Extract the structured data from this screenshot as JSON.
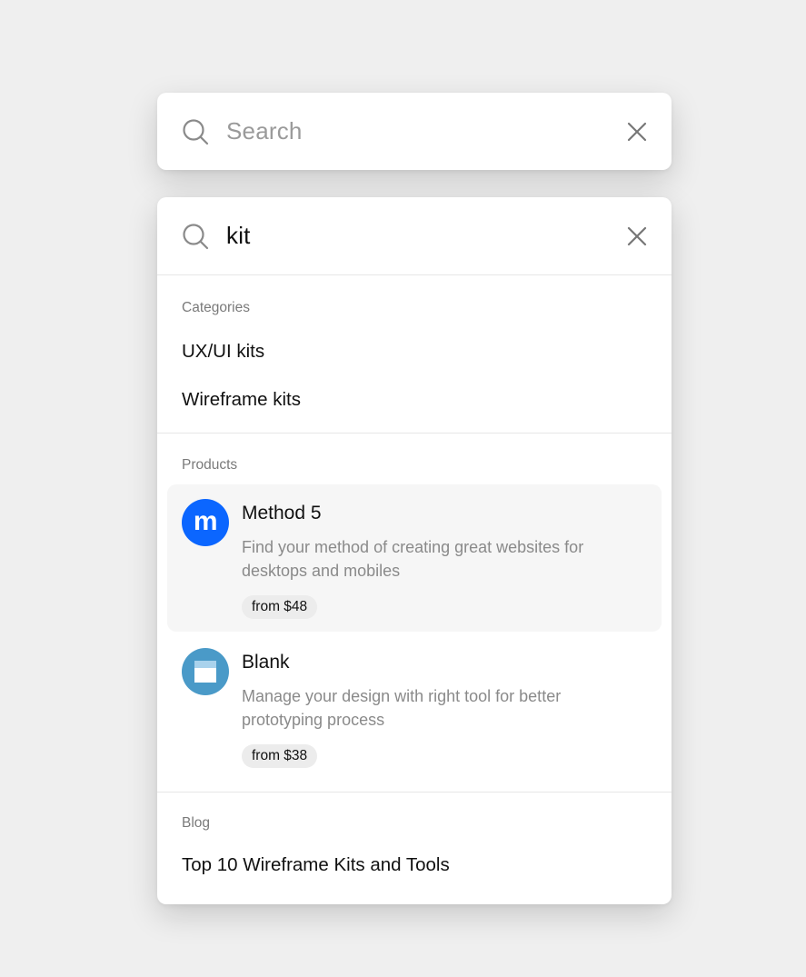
{
  "empty_search": {
    "placeholder": "Search",
    "icon": "search-icon",
    "clear_icon": "close-icon"
  },
  "active_search": {
    "query": "kit",
    "icon": "search-icon",
    "clear_icon": "close-icon"
  },
  "sections": {
    "categories": {
      "label": "Categories",
      "items": [
        "UX/UI kits",
        "Wireframe kits"
      ]
    },
    "products": {
      "label": "Products",
      "items": [
        {
          "title": "Method 5",
          "description": "Find your method of creating great websites for desktops and mobiles",
          "price": "from $48",
          "logo_letter": "m",
          "logo_color": "#0b66ff",
          "highlighted": true
        },
        {
          "title": "Blank",
          "description": "Manage your design with right tool for better prototyping process",
          "price": "from $38",
          "logo_icon": "window-icon",
          "logo_color": "#4a9ac8",
          "highlighted": false
        }
      ]
    },
    "blog": {
      "label": "Blog",
      "items": [
        "Top 10 Wireframe Kits and Tools"
      ]
    }
  },
  "colors": {
    "background": "#efefef",
    "card": "#ffffff",
    "highlight": "#f6f6f6",
    "muted_text": "#8a8a8a",
    "price_chip": "#ececec"
  }
}
